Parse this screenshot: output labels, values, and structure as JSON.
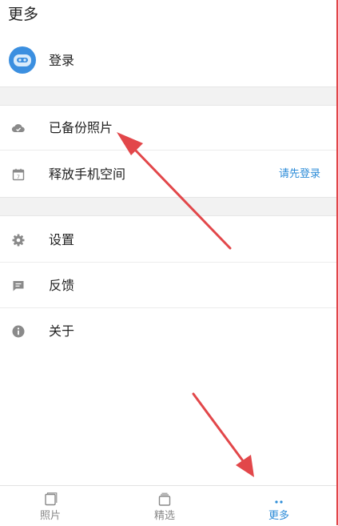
{
  "header": {
    "title": "更多"
  },
  "login": {
    "label": "登录"
  },
  "menu_group_1": [
    {
      "label": "已备份照片",
      "icon": "cloud-check-icon"
    },
    {
      "label": "释放手机空间",
      "icon": "calendar-icon",
      "action": "请先登录"
    }
  ],
  "menu_group_2": [
    {
      "label": "设置",
      "icon": "gear-icon"
    },
    {
      "label": "反馈",
      "icon": "feedback-icon"
    },
    {
      "label": "关于",
      "icon": "info-icon"
    }
  ],
  "bottom_nav": {
    "items": [
      {
        "label": "照片",
        "icon": "photo-icon",
        "active": false
      },
      {
        "label": "精选",
        "icon": "album-icon",
        "active": false
      },
      {
        "label": "更多",
        "icon": "more-icon",
        "active": true
      }
    ]
  },
  "colors": {
    "accent": "#2d8cd8",
    "annotation_arrow": "#e2474a",
    "icon_gray": "#8a8a8a"
  }
}
